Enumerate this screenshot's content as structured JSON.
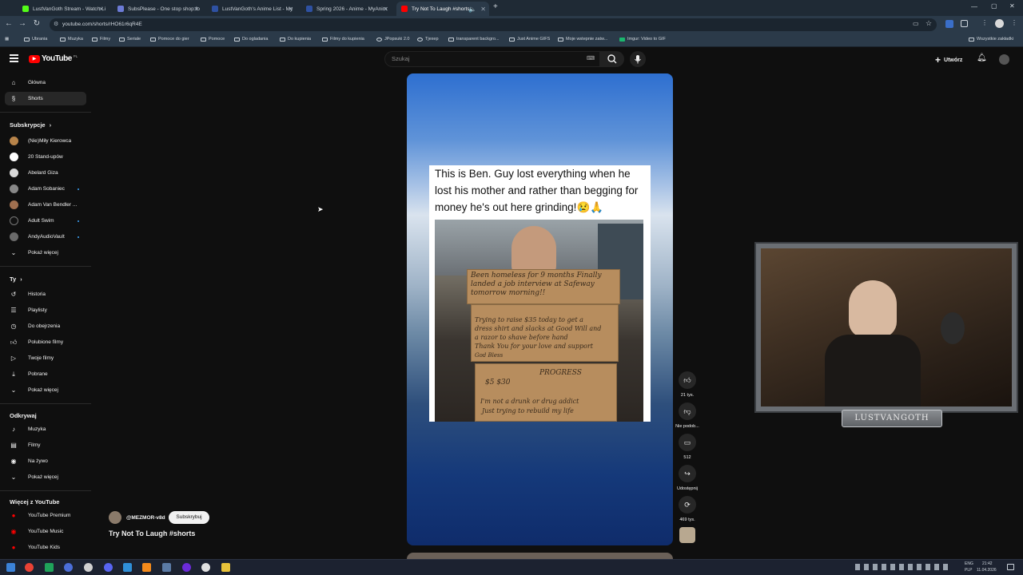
{
  "browser": {
    "tabs": [
      {
        "label": "LustVanGoth Stream - Watch Li",
        "color": "#53fc18"
      },
      {
        "label": "SubsPlease - One stop shop fo",
        "color": "#6c7bd6"
      },
      {
        "label": "LustVanGoth's Anime List - My",
        "color": "#2e51a2"
      },
      {
        "label": "Spring 2026 - Anime - MyAnim",
        "color": "#2e51a2"
      },
      {
        "label": "Try Not To Laugh #shorts",
        "color": "#ff0000"
      }
    ],
    "url": "youtube.com/shorts/rHO61r6qR4E",
    "bookmarks": [
      "Ubrania",
      "Muzyka",
      "Filmy",
      "Seriale",
      "Pomoce do gier",
      "Pomoce",
      "Do ogladania",
      "Do kupienia",
      "Filmy do kupienia",
      "JPopsuki 2.0",
      "Tjexep",
      "transparent backgro...",
      "Just Anime GIFS",
      "Moje wstepnie zatw...",
      "Imgur: Video to GIF"
    ],
    "all_bookmarks": "Wszystkie zakładki"
  },
  "youtube": {
    "logo_text": "YouTube",
    "logo_region": "PL",
    "search_placeholder": "Szukaj",
    "create_label": "Utwórz",
    "sidebar": {
      "main": [
        {
          "label": "Główna",
          "icon": "home-icon"
        },
        {
          "label": "Shorts",
          "icon": "shorts-icon"
        }
      ],
      "subscriptions_heading": "Subskrypcje",
      "subscriptions": [
        {
          "label": "(Nie)Miły Kierowca",
          "color": "#b8844a",
          "dot": false
        },
        {
          "label": "20 Stand-upów",
          "color": "#ffffff",
          "dot": false
        },
        {
          "label": "Abelard Giza",
          "color": "#d9d9d9",
          "dot": false
        },
        {
          "label": "Adam Sobaniec",
          "color": "#888888",
          "dot": true
        },
        {
          "label": "Adam Van Bendler ...",
          "color": "#a07050",
          "dot": false
        },
        {
          "label": "Adult Swim",
          "color": "#111111",
          "dot": true
        },
        {
          "label": "AndyAudioVault",
          "color": "#6a6a6a",
          "dot": true
        }
      ],
      "show_more": "Pokaż więcej",
      "you_heading": "Ty",
      "you": [
        {
          "label": "Historia",
          "icon": "history-icon"
        },
        {
          "label": "Playlisty",
          "icon": "playlist-icon"
        },
        {
          "label": "Do obejrzenia",
          "icon": "watch-later-icon"
        },
        {
          "label": "Polubione filmy",
          "icon": "liked-icon"
        },
        {
          "label": "Twoje filmy",
          "icon": "your-videos-icon"
        },
        {
          "label": "Pobrane",
          "icon": "download-icon"
        },
        {
          "label": "Pokaż więcej",
          "icon": "chevron-down-icon"
        }
      ],
      "explore_heading": "Odkrywaj",
      "explore": [
        {
          "label": "Muzyka",
          "icon": "music-icon"
        },
        {
          "label": "Filmy",
          "icon": "film-icon"
        },
        {
          "label": "Na żywo",
          "icon": "live-icon"
        },
        {
          "label": "Pokaż więcej",
          "icon": "chevron-down-icon"
        }
      ],
      "more_heading": "Więcej z YouTube",
      "more": [
        {
          "label": "YouTube Premium"
        },
        {
          "label": "YouTube Music"
        },
        {
          "label": "YouTube Kids"
        }
      ]
    },
    "short": {
      "post_text": "This is Ben. Guy lost everything when he lost his mother and rather than begging for money he's out here grinding!😢🙏",
      "sign_lines": [
        "Been homeless for 9 months Finally",
        "landed a job interview at Safeway",
        "tomorrow morning!!",
        "Trying to raise $35 today to get a",
        "dress shirt and slacks at Good Will and",
        "a razor to shave before hand",
        "Thank You for your love and support",
        "God Bless",
        "PROGRESS",
        "$5 $30",
        "I'm not a drunk or drug addict",
        "Just trying to rebuild my life"
      ],
      "channel": "@MEZMOR-v8d",
      "subscribe_label": "Subskrybuj",
      "title": "Try Not To Laugh #shorts",
      "actions": [
        {
          "icon": "like-icon",
          "label": "21 tys."
        },
        {
          "icon": "dislike-icon",
          "label": "Nie podob..."
        },
        {
          "icon": "comment-icon",
          "label": "512"
        },
        {
          "icon": "share-icon",
          "label": "Udostępnij"
        },
        {
          "icon": "remix-icon",
          "label": "469 tys."
        }
      ]
    }
  },
  "overlay": {
    "streamer_name": "LUSTVANGOTH"
  },
  "taskbar": {
    "lang": "ENG",
    "lang2": "PLP",
    "time": "21:42",
    "date": "11.04.2026"
  }
}
